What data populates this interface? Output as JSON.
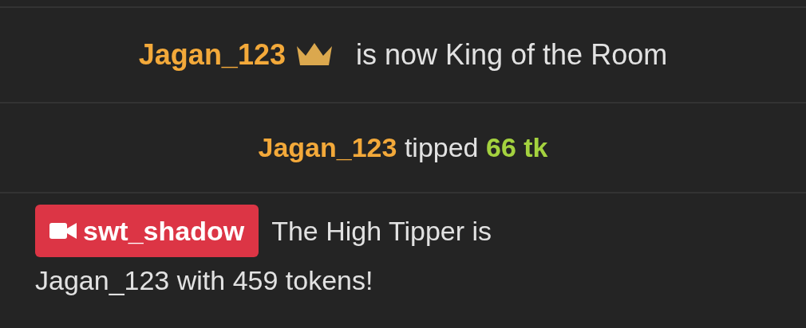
{
  "messages": [
    {
      "kind": "king",
      "user": "Jagan_123",
      "text": "is now King of the Room"
    },
    {
      "kind": "tip",
      "user": "Jagan_123",
      "verb": "tipped",
      "amount": "66 tk"
    },
    {
      "kind": "broadcaster",
      "user": "swt_shadow",
      "lines": [
        "The High Tipper is",
        "Jagan_123 with 459 tokens!"
      ]
    }
  ]
}
